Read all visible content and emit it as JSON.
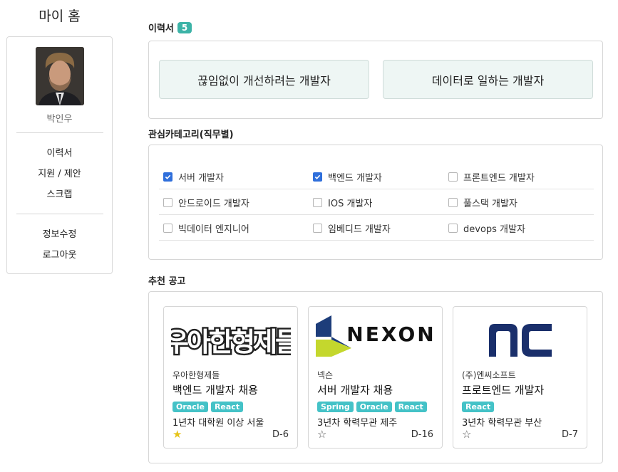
{
  "sidebar": {
    "page_title": "마이 홈",
    "user_name": "박인우",
    "nav": [
      "이력서",
      "지원 / 제안",
      "스크랩"
    ],
    "account": [
      "정보수정",
      "로그아웃"
    ]
  },
  "resume": {
    "title": "이력서",
    "count": "5",
    "items": [
      "끊임없이 개선하려는 개발자",
      "데이터로 일하는 개발자"
    ]
  },
  "categories": {
    "title": "관심카테고리(직무별)",
    "rows": [
      [
        {
          "label": "서버 개발자",
          "checked": true
        },
        {
          "label": "백엔드 개발자",
          "checked": true
        },
        {
          "label": "프론트엔드 개발자",
          "checked": false
        }
      ],
      [
        {
          "label": "안드로이드 개발자",
          "checked": false
        },
        {
          "label": "IOS 개발자",
          "checked": false
        },
        {
          "label": "풀스택 개발자",
          "checked": false
        }
      ],
      [
        {
          "label": "빅데이터 엔지니어",
          "checked": false
        },
        {
          "label": "임베디드 개발자",
          "checked": false
        },
        {
          "label": "devops 개발자",
          "checked": false
        }
      ]
    ]
  },
  "recommend": {
    "title": "추천 공고",
    "jobs": [
      {
        "logo_text": "우아한형제들",
        "company": "우아한형제들",
        "title": "백엔드 개발자 채용",
        "tags": [
          "Oracle",
          "React"
        ],
        "meta": "1년차 대학원 이상 서울",
        "starred": true,
        "dday": "D-6"
      },
      {
        "logo_text": "NEXON",
        "company": "넥슨",
        "title": "서버 개발자 채용",
        "tags": [
          "Spring",
          "Oracle",
          "React"
        ],
        "meta": "3년차 학력무관 제주",
        "starred": false,
        "dday": "D-16"
      },
      {
        "logo_text": "nc",
        "company": "(주)엔씨소프트",
        "title": "프로트엔드 개발자",
        "tags": [
          "React"
        ],
        "meta": "3년차 학력무관 부산",
        "starred": false,
        "dday": "D-7"
      }
    ]
  },
  "colors": {
    "accent": "#3cb3a7",
    "tag": "#44c2c7",
    "checkbox": "#2f6fdb",
    "star": "#e6c41a",
    "nexon_blue": "#1d3d7a",
    "nexon_lime": "#c4d72d",
    "nc_navy": "#1a2f6b"
  }
}
